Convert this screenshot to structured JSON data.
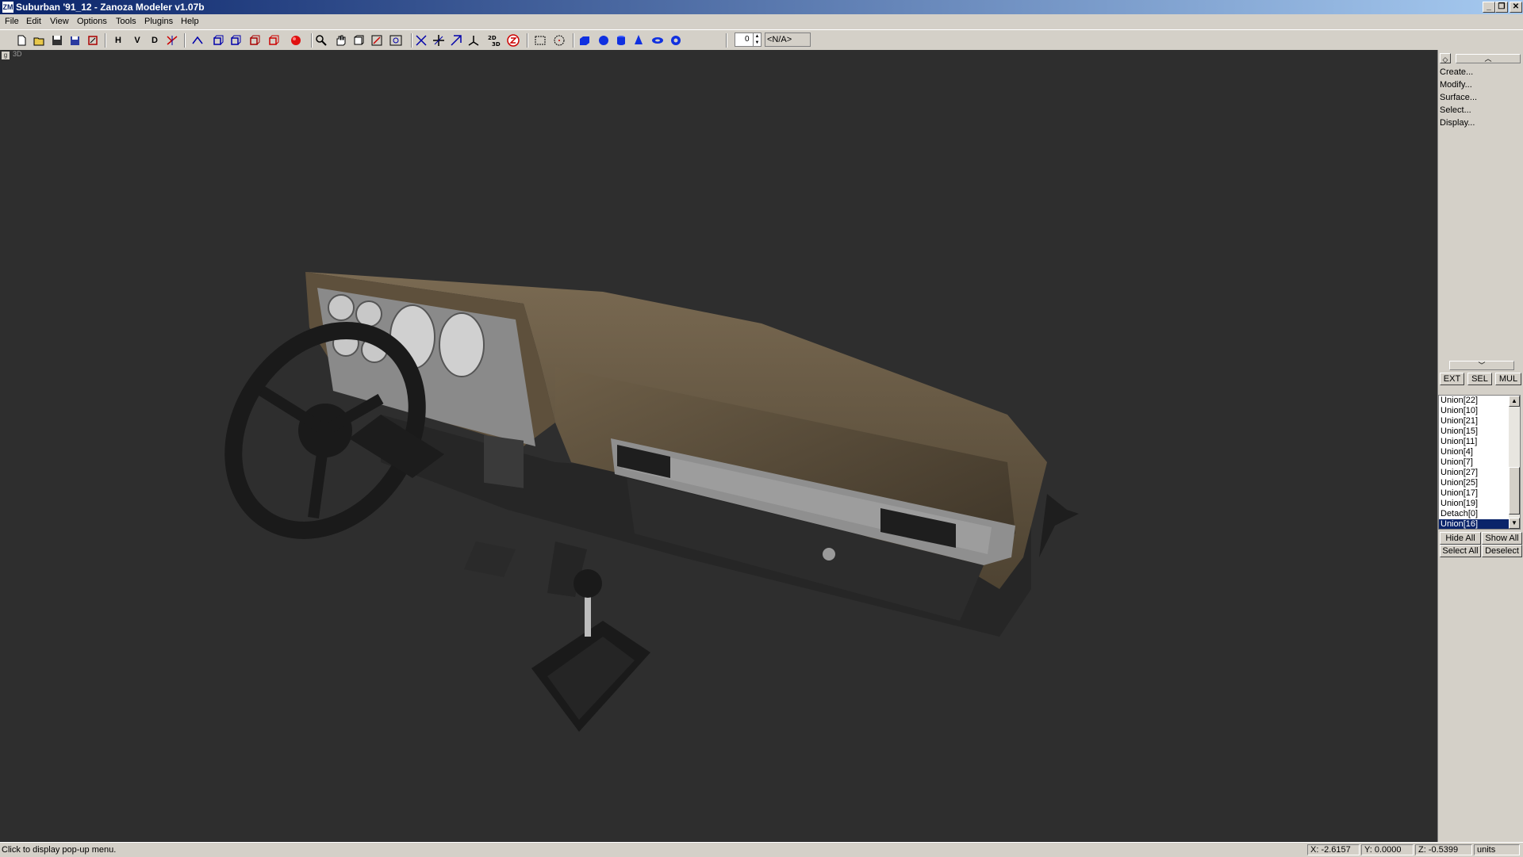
{
  "window": {
    "title": "Suburban '91_12 - Zanoza Modeler v1.07b",
    "app_icon": "ZM"
  },
  "menu": [
    "File",
    "Edit",
    "View",
    "Options",
    "Tools",
    "Plugins",
    "Help"
  ],
  "toolbar": {
    "h_label": "H",
    "v_label": "V",
    "d_label": "D",
    "frame_value": "0",
    "object_label": "<N/A>"
  },
  "viewport": {
    "corner_label": "g",
    "view_label": "3D"
  },
  "panel": {
    "commands": [
      "Create...",
      "Modify...",
      "Surface...",
      "Select...",
      "Display..."
    ],
    "mode_buttons": [
      "EXT",
      "SEL",
      "MUL"
    ],
    "objects": [
      "Union[22]",
      "Union[10]",
      "Union[21]",
      "Union[15]",
      "Union[11]",
      "Union[4]",
      "Union[7]",
      "Union[27]",
      "Union[25]",
      "Union[17]",
      "Union[19]",
      "Detach[0]",
      "Union[16]"
    ],
    "selected_object": "Union[16]",
    "hide_all": "Hide All",
    "show_all": "Show All",
    "select_all": "Select All",
    "deselect": "Deselect"
  },
  "status": {
    "message": "Click to display pop-up menu.",
    "x": "X: -2.6157",
    "y": "Y: 0.0000",
    "z": "Z: -0.5399",
    "units": "units"
  }
}
